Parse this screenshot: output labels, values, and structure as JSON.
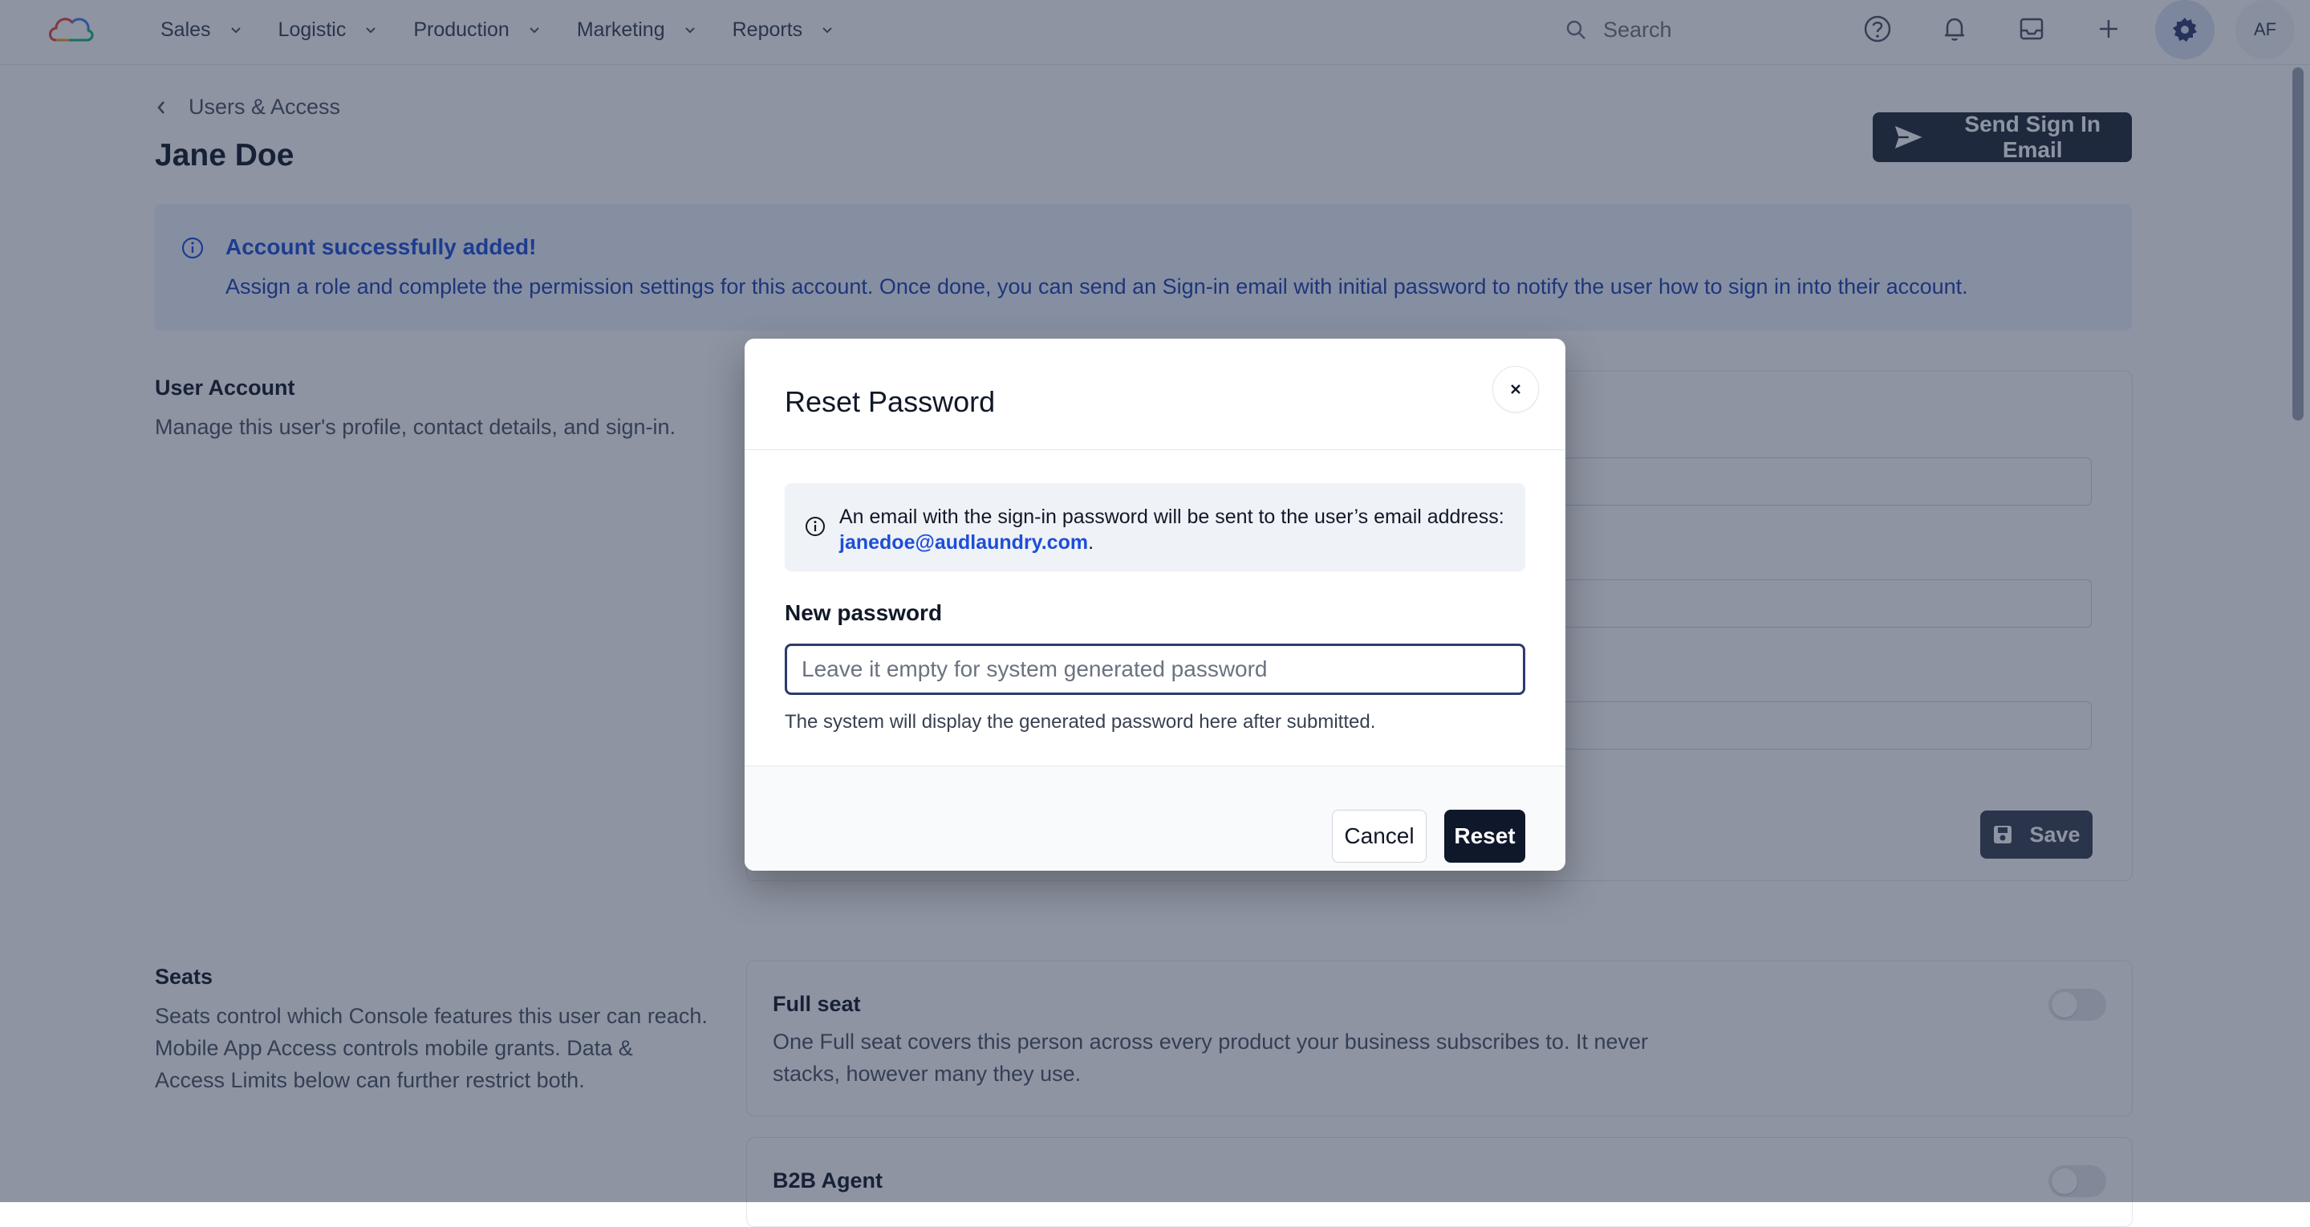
{
  "nav": {
    "items": [
      {
        "label": "Sales"
      },
      {
        "label": "Logistic"
      },
      {
        "label": "Production"
      },
      {
        "label": "Marketing"
      },
      {
        "label": "Reports"
      }
    ],
    "search_placeholder": "Search",
    "avatar_initials": "AF",
    "accent_color": "#dbe3f3"
  },
  "page": {
    "breadcrumb": "Users & Access",
    "title": "Jane Doe",
    "send_button": "Send Sign In Email"
  },
  "alert": {
    "title": "Account successfully added!",
    "body": "Assign a role and complete the permission settings for this account. Once done, you can send an Sign-in email with initial password to notify the user how to sign in into their account."
  },
  "user_account": {
    "title": "User Account",
    "description": "Manage this user's profile, contact details, and sign-in.",
    "save_label": "Save"
  },
  "seats": {
    "title": "Seats",
    "description_lines": [
      "Seats control which Console features this user can reach.",
      "Mobile App Access controls mobile grants. Data &",
      "Access Limits below can further restrict both."
    ],
    "cards": [
      {
        "title": "Full seat",
        "description_lines": [
          "One Full seat covers this person across every product your business subscribes to. It never",
          "stacks, however many they use."
        ],
        "enabled": false
      },
      {
        "title": "B2B Agent",
        "enabled": false
      }
    ]
  },
  "modal": {
    "title": "Reset Password",
    "info_text": "An email with the sign-in password will be sent to the user’s email address:",
    "info_email": "janedoe@audlaundry.com",
    "info_suffix": ".",
    "field_label": "New password",
    "field_placeholder": "Leave it empty for system generated password",
    "field_value": "",
    "help_text": "The system will display the generated password here after submitted.",
    "cancel_label": "Cancel",
    "reset_label": "Reset"
  }
}
